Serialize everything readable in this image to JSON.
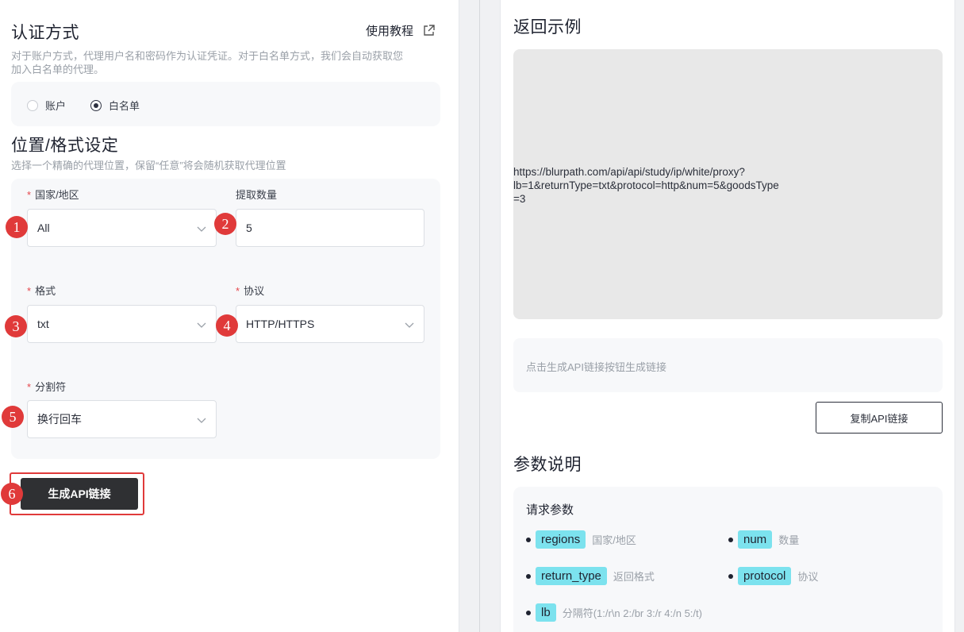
{
  "auth": {
    "title": "认证方式",
    "tutorial_label": "使用教程",
    "description_line1": "对于账户方式，代理用户名和密码作为认证凭证。对于白名单方式，我们会自动获取您",
    "description_line2": "加入白名单的代理。",
    "options": [
      {
        "label": "账户",
        "checked": false
      },
      {
        "label": "白名单",
        "checked": true
      }
    ]
  },
  "location": {
    "title": "位置/格式设定",
    "description": "选择一个精确的代理位置，保留“任意”将会随机获取代理位置",
    "fields": {
      "country": {
        "label": "国家/地区",
        "required": true,
        "value": "All"
      },
      "quantity": {
        "label": "提取数量",
        "required": false,
        "value": "5"
      },
      "format": {
        "label": "格式",
        "required": true,
        "value": "txt"
      },
      "protocol": {
        "label": "协议",
        "required": true,
        "value": "HTTP/HTTPS"
      },
      "separator": {
        "label": "分割符",
        "required": true,
        "value": "换行回车"
      }
    }
  },
  "badges": [
    "1",
    "2",
    "3",
    "4",
    "5",
    "6"
  ],
  "generate_button": "生成API链接",
  "example": {
    "title": "返回示例",
    "url_line1": "https://blurpath.com/api/api/study/ip/white/proxy?",
    "url_line2": "lb=1&returnType=txt&protocol=http&num=5&goodsType=3",
    "hint": "点击生成API链接按钮生成链接",
    "copy_button": "复制API链接"
  },
  "params": {
    "title": "参数说明",
    "subtitle": "请求参数",
    "items": [
      {
        "name": "regions",
        "desc": "国家/地区"
      },
      {
        "name": "num",
        "desc": "数量"
      },
      {
        "name": "return_type",
        "desc": "返回格式"
      },
      {
        "name": "protocol",
        "desc": "协议"
      },
      {
        "name": "lb",
        "desc": "分隔符(1:/r\\n 2:/br 3:/r 4:/n 5:/t)"
      }
    ]
  },
  "colors": {
    "badge": "#e03a3a",
    "button": "#2f3033",
    "tag": "#7ce2ee",
    "required": "#e5484d"
  }
}
